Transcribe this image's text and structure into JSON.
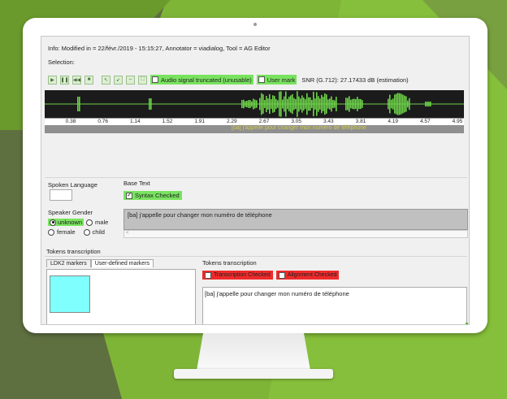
{
  "info": {
    "text": "Info: Modified in = 22/févr./2019 - 15:15:27, Annotator = viadialog, Tool = AG Editor"
  },
  "selection": {
    "label": "Selection:"
  },
  "toolbar": {
    "buttons": [
      "play-icon",
      "pause-icon",
      "rewind-icon",
      "stop-icon",
      "zoom-in-icon",
      "zoom-out-icon",
      "zoom-fit-icon",
      "zoom-all-icon"
    ],
    "glyphs": [
      "▶",
      "❚❚",
      "◀◀",
      "■",
      "↖",
      "↙",
      "⇔",
      "⛶"
    ],
    "truncated_label": "Audio signal truncated (unusable)",
    "user_mark_label": "User mark",
    "snr_text": "SNR (G.712): 27.17433 dB (estimation)"
  },
  "axis": {
    "ticks": [
      "0.38",
      "0.76",
      "1.14",
      "1.52",
      "1.91",
      "2.29",
      "2.67",
      "3.05",
      "3.43",
      "3.81",
      "4.19",
      "4.57",
      "4.95"
    ]
  },
  "segment": {
    "text": "[ba] j'appelle pour changer mon numéro de téléphone"
  },
  "spoken_language": {
    "label": "Spoken Language",
    "value": ""
  },
  "speaker_gender": {
    "label": "Speaker Gender",
    "options": [
      "unknown",
      "male",
      "female",
      "child"
    ],
    "selected": "unknown"
  },
  "base_text": {
    "label": "Base Text",
    "syntax_label": "Syntax Checked",
    "value": "[ba] j'appelle pour changer mon numéro de téléphone",
    "scroll_marker": "<"
  },
  "tokens": {
    "section_label": "Tokens transcription",
    "tabs": [
      "LDK2 markers",
      "User-defined markers"
    ],
    "panel_label": "Tokens transcription",
    "transcription_checked": "Transcription Checked",
    "alignment_checked": "Alignment Checked",
    "value": "[ba] j'appelle pour changer mon numéro de téléphone"
  },
  "colors": {
    "waveform": "#6ed24a",
    "highlight_green": "#79e35f",
    "check_red": "#f02a2a",
    "marker_cyan": "#80ffff",
    "segment_text": "#d3cd4c"
  }
}
